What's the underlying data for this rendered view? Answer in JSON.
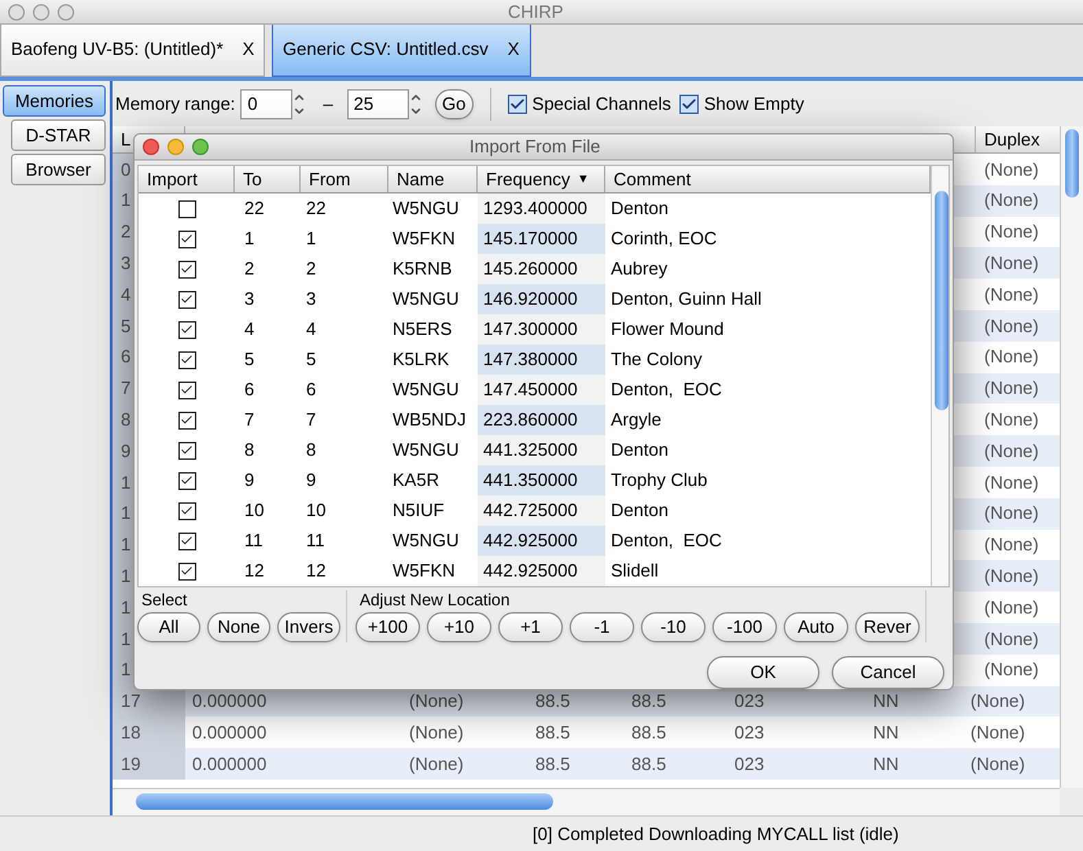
{
  "window": {
    "title": "CHIRP"
  },
  "tabs": [
    {
      "label": "Baofeng UV-B5: (Untitled)*",
      "close": "X",
      "selected": false
    },
    {
      "label": "Generic CSV: Untitled.csv",
      "close": "X",
      "selected": true
    }
  ],
  "side_tabs": [
    {
      "label": "Memories",
      "selected": true
    },
    {
      "label": "D-STAR",
      "selected": false
    },
    {
      "label": "Browser",
      "selected": false
    }
  ],
  "toolbar": {
    "range_label": "Memory range:",
    "range_start": "0",
    "range_separator": "–",
    "range_end": "25",
    "go": "Go",
    "checks": [
      {
        "label": "Special Channels",
        "checked": true
      },
      {
        "label": "Show Empty",
        "checked": true
      }
    ]
  },
  "memory_table": {
    "columns": [
      "L",
      "Duplex"
    ],
    "rows": [
      {
        "kind": "covered",
        "cells": [
          "0",
          "(None)"
        ]
      },
      {
        "kind": "covered",
        "cells": [
          "1",
          "(None)"
        ]
      },
      {
        "kind": "covered",
        "cells": [
          "2",
          "(None)"
        ]
      },
      {
        "kind": "covered",
        "cells": [
          "3",
          "(None)"
        ]
      },
      {
        "kind": "covered",
        "cells": [
          "4",
          "(None)"
        ]
      },
      {
        "kind": "covered",
        "cells": [
          "5",
          "(None)"
        ]
      },
      {
        "kind": "covered",
        "cells": [
          "6",
          "(None)"
        ]
      },
      {
        "kind": "covered",
        "cells": [
          "7",
          "(None)"
        ]
      },
      {
        "kind": "covered",
        "cells": [
          "8",
          "(None)"
        ]
      },
      {
        "kind": "covered",
        "cells": [
          "9",
          "(None)"
        ]
      },
      {
        "kind": "covered",
        "cells": [
          "1",
          "(None)"
        ]
      },
      {
        "kind": "covered",
        "cells": [
          "1",
          "(None)"
        ]
      },
      {
        "kind": "covered",
        "cells": [
          "1",
          "(None)"
        ]
      },
      {
        "kind": "covered",
        "cells": [
          "1",
          "(None)"
        ]
      },
      {
        "kind": "covered",
        "cells": [
          "1",
          "(None)"
        ]
      },
      {
        "kind": "covered",
        "cells": [
          "1",
          "(None)"
        ]
      },
      {
        "kind": "covered",
        "cells": [
          "1",
          "(None)"
        ]
      },
      {
        "kind": "full",
        "cells": [
          "17",
          "0.000000",
          "(None)",
          "88.5",
          "88.5",
          "023",
          "NN",
          "(None)"
        ]
      },
      {
        "kind": "full",
        "cells": [
          "18",
          "0.000000",
          "(None)",
          "88.5",
          "88.5",
          "023",
          "NN",
          "(None)"
        ]
      },
      {
        "kind": "full",
        "cells": [
          "19",
          "0.000000",
          "(None)",
          "88.5",
          "88.5",
          "023",
          "NN",
          "(None)"
        ]
      }
    ]
  },
  "dialog": {
    "title": "Import From File",
    "columns": [
      "Import",
      "To",
      "From",
      "Name",
      "Frequency",
      "Comment"
    ],
    "sort_mark": "▼",
    "rows": [
      {
        "import": false,
        "to": "22",
        "from": "22",
        "name": "W5NGU",
        "frequency": "1293.400000",
        "comment": "Denton"
      },
      {
        "import": true,
        "to": "1",
        "from": "1",
        "name": "W5FKN",
        "frequency": "145.170000",
        "comment": "Corinth, EOC"
      },
      {
        "import": true,
        "to": "2",
        "from": "2",
        "name": "K5RNB",
        "frequency": "145.260000",
        "comment": "Aubrey"
      },
      {
        "import": true,
        "to": "3",
        "from": "3",
        "name": "W5NGU",
        "frequency": "146.920000",
        "comment": "Denton, Guinn Hall"
      },
      {
        "import": true,
        "to": "4",
        "from": "4",
        "name": "N5ERS",
        "frequency": "147.300000",
        "comment": "Flower Mound"
      },
      {
        "import": true,
        "to": "5",
        "from": "5",
        "name": "K5LRK",
        "frequency": "147.380000",
        "comment": "The Colony"
      },
      {
        "import": true,
        "to": "6",
        "from": "6",
        "name": "W5NGU",
        "frequency": "147.450000",
        "comment": "Denton,  EOC"
      },
      {
        "import": true,
        "to": "7",
        "from": "7",
        "name": "WB5NDJ",
        "frequency": "223.860000",
        "comment": "Argyle"
      },
      {
        "import": true,
        "to": "8",
        "from": "8",
        "name": "W5NGU",
        "frequency": "441.325000",
        "comment": "Denton"
      },
      {
        "import": true,
        "to": "9",
        "from": "9",
        "name": "KA5R",
        "frequency": "441.350000",
        "comment": "Trophy Club"
      },
      {
        "import": true,
        "to": "10",
        "from": "10",
        "name": "N5IUF",
        "frequency": "442.725000",
        "comment": "Denton"
      },
      {
        "import": true,
        "to": "11",
        "from": "11",
        "name": "W5NGU",
        "frequency": "442.925000",
        "comment": "Denton,  EOC"
      },
      {
        "import": true,
        "to": "12",
        "from": "12",
        "name": "W5FKN",
        "frequency": "442.925000",
        "comment": "Slidell"
      }
    ],
    "select_group": {
      "label": "Select",
      "buttons": [
        "All",
        "None",
        "Invers"
      ]
    },
    "adjust_group": {
      "label": "Adjust New Location",
      "buttons": [
        "+100",
        "+10",
        "+1",
        "-1",
        "-10",
        "-100",
        "Auto",
        "Rever"
      ]
    },
    "buttons": [
      "OK",
      "Cancel"
    ]
  },
  "status_bar": "[0] Completed Downloading MYCALL list (idle)"
}
